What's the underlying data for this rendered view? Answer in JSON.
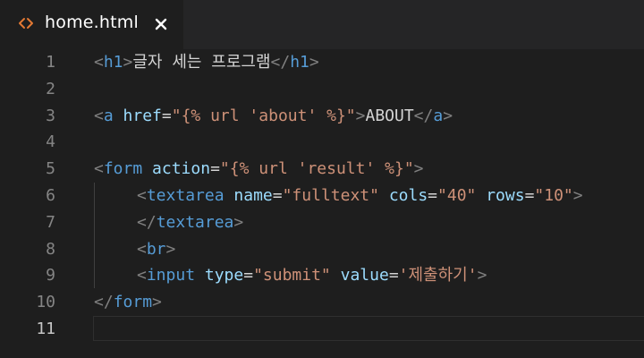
{
  "tab": {
    "icon": "code-brackets-icon",
    "label": "home.html",
    "close_icon": "close-icon",
    "icon_color": "#e37933"
  },
  "lines": [
    {
      "number": "1",
      "tokens": [
        {
          "t": "punct",
          "v": "<"
        },
        {
          "t": "tag",
          "v": "h1"
        },
        {
          "t": "punct",
          "v": ">"
        },
        {
          "t": "text",
          "v": "글자 세는 프로그램"
        },
        {
          "t": "punct",
          "v": "</"
        },
        {
          "t": "tag",
          "v": "h1"
        },
        {
          "t": "punct",
          "v": ">"
        }
      ]
    },
    {
      "number": "2",
      "tokens": []
    },
    {
      "number": "3",
      "tokens": [
        {
          "t": "punct",
          "v": "<"
        },
        {
          "t": "tag",
          "v": "a"
        },
        {
          "t": "text",
          "v": " "
        },
        {
          "t": "attr",
          "v": "href"
        },
        {
          "t": "eq",
          "v": "="
        },
        {
          "t": "str",
          "v": "\"{% url 'about' %}\""
        },
        {
          "t": "punct",
          "v": ">"
        },
        {
          "t": "text",
          "v": "ABOUT"
        },
        {
          "t": "punct",
          "v": "</"
        },
        {
          "t": "tag",
          "v": "a"
        },
        {
          "t": "punct",
          "v": ">"
        }
      ]
    },
    {
      "number": "4",
      "tokens": []
    },
    {
      "number": "5",
      "tokens": [
        {
          "t": "punct",
          "v": "<"
        },
        {
          "t": "tag",
          "v": "form"
        },
        {
          "t": "text",
          "v": " "
        },
        {
          "t": "attr",
          "v": "action"
        },
        {
          "t": "eq",
          "v": "="
        },
        {
          "t": "str",
          "v": "\"{% url 'result' %}\""
        },
        {
          "t": "punct",
          "v": ">"
        }
      ]
    },
    {
      "number": "6",
      "indent": true,
      "tokens": [
        {
          "t": "punct",
          "v": "<"
        },
        {
          "t": "tag",
          "v": "textarea"
        },
        {
          "t": "text",
          "v": " "
        },
        {
          "t": "attr",
          "v": "name"
        },
        {
          "t": "eq",
          "v": "="
        },
        {
          "t": "str",
          "v": "\"fulltext\""
        },
        {
          "t": "text",
          "v": " "
        },
        {
          "t": "attr",
          "v": "cols"
        },
        {
          "t": "eq",
          "v": "="
        },
        {
          "t": "str",
          "v": "\"40\""
        },
        {
          "t": "text",
          "v": " "
        },
        {
          "t": "attr",
          "v": "rows"
        },
        {
          "t": "eq",
          "v": "="
        },
        {
          "t": "str",
          "v": "\"10\""
        },
        {
          "t": "punct",
          "v": ">"
        }
      ]
    },
    {
      "number": "7",
      "indent": true,
      "tokens": [
        {
          "t": "punct",
          "v": "</"
        },
        {
          "t": "tag",
          "v": "textarea"
        },
        {
          "t": "punct",
          "v": ">"
        }
      ]
    },
    {
      "number": "8",
      "indent": true,
      "tokens": [
        {
          "t": "punct",
          "v": "<"
        },
        {
          "t": "tag",
          "v": "br"
        },
        {
          "t": "punct",
          "v": ">"
        }
      ]
    },
    {
      "number": "9",
      "indent": true,
      "tokens": [
        {
          "t": "punct",
          "v": "<"
        },
        {
          "t": "tag",
          "v": "input"
        },
        {
          "t": "text",
          "v": " "
        },
        {
          "t": "attr",
          "v": "type"
        },
        {
          "t": "eq",
          "v": "="
        },
        {
          "t": "str",
          "v": "\"submit\""
        },
        {
          "t": "text",
          "v": " "
        },
        {
          "t": "attr",
          "v": "value"
        },
        {
          "t": "eq",
          "v": "="
        },
        {
          "t": "str",
          "v": "'제출하기'"
        },
        {
          "t": "punct",
          "v": ">"
        }
      ]
    },
    {
      "number": "10",
      "tokens": [
        {
          "t": "punct",
          "v": "</"
        },
        {
          "t": "tag",
          "v": "form"
        },
        {
          "t": "punct",
          "v": ">"
        }
      ]
    },
    {
      "number": "11",
      "active": true,
      "tokens": []
    }
  ]
}
